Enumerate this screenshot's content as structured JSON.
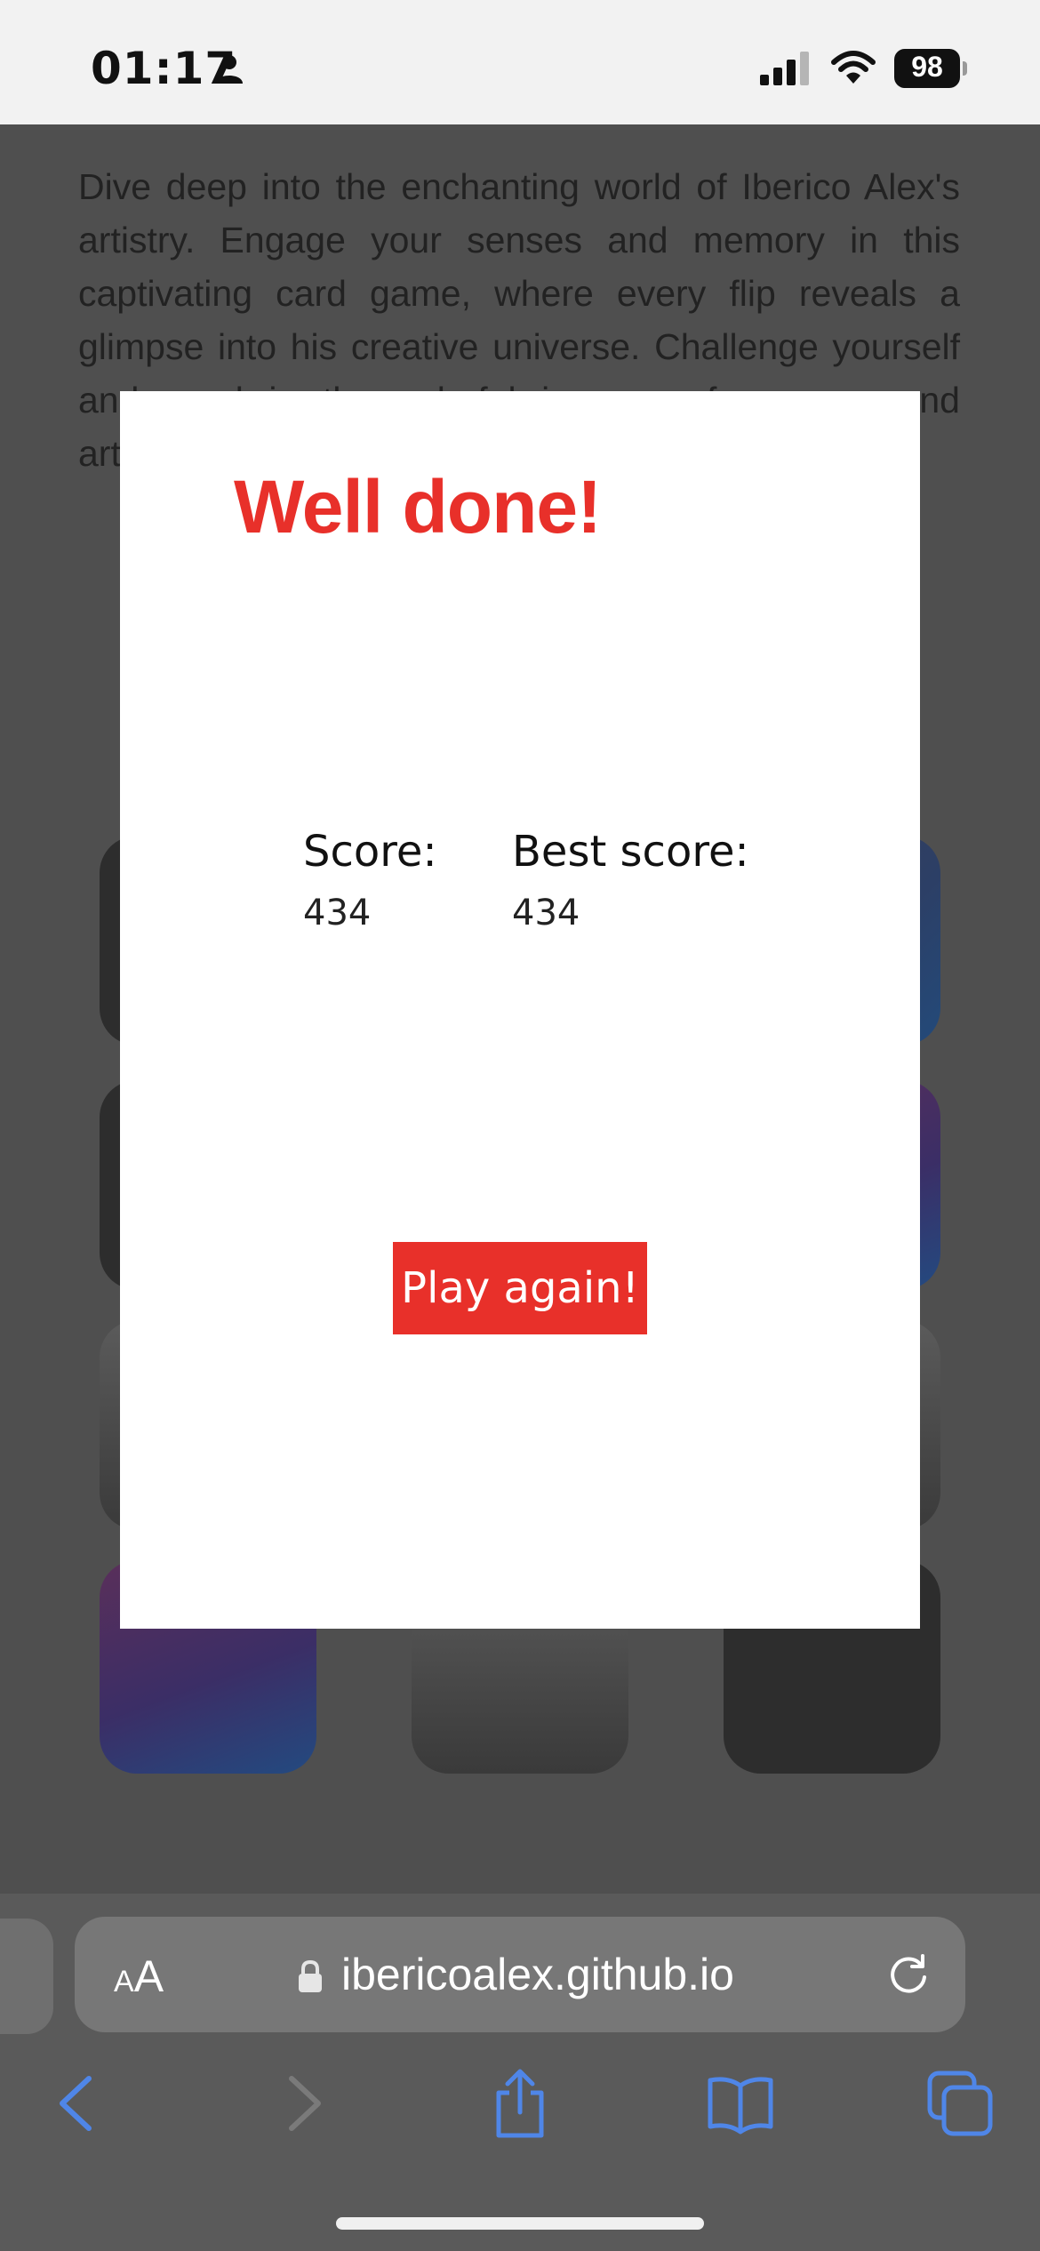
{
  "status_bar": {
    "time": "01:17",
    "battery": "98",
    "icons": [
      "person-icon",
      "signal-icon",
      "wifi-icon",
      "battery-icon"
    ]
  },
  "page": {
    "intro_text": "Dive deep into the enchanting world of Iberico Alex's artistry. Engage your senses and memory in this captivating card game, where every flip reveals a glimpse into his creative universe. Challenge yourself and revel in the colorful journey of memory and artistry!"
  },
  "modal": {
    "title": "Well done!",
    "score_label": "Score:",
    "score_value": "434",
    "best_label": "Best score:",
    "best_value": "434",
    "button_label": "Play again!"
  },
  "browser": {
    "aa_small": "A",
    "aa_large": "A",
    "url": "ibericoalex.github.io"
  },
  "colors": {
    "accent": "#e8302a",
    "toolbar_icon": "#4f86e8",
    "toolbar_disabled": "#7a7a7a"
  }
}
